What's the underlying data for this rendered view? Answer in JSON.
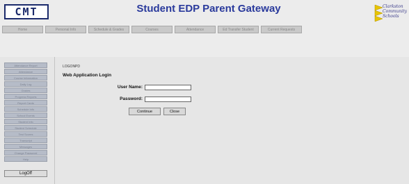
{
  "header": {
    "logo_text": "CMT",
    "title": "Student EDP Parent Gateway",
    "district_logo_lines": [
      "Clarkston",
      "Community",
      "Schools"
    ]
  },
  "topnav": {
    "items": [
      {
        "label": "Home"
      },
      {
        "label": "Personal Info"
      },
      {
        "label": "Schedule & Grades"
      },
      {
        "label": "Courses"
      },
      {
        "label": "Attendance"
      },
      {
        "label": "Ed Transfer Student"
      },
      {
        "label": "Current Requests"
      }
    ]
  },
  "sidebar": {
    "items": [
      {
        "label": "Attendance Report"
      },
      {
        "label": "Attendance"
      },
      {
        "label": "Course Information"
      },
      {
        "label": "Daily Log"
      },
      {
        "label": "Grades"
      },
      {
        "label": "Progress Reports"
      },
      {
        "label": "Report Cards"
      },
      {
        "label": "Schedule Info"
      },
      {
        "label": "School Events"
      },
      {
        "label": "Student Info"
      },
      {
        "label": "Student Schedule"
      },
      {
        "label": "Test Scores"
      },
      {
        "label": "Transcript"
      },
      {
        "label": "Messages"
      },
      {
        "label": "Change Password"
      },
      {
        "label": "Help"
      },
      {
        "label": "LogOff"
      }
    ]
  },
  "main": {
    "breadcrumb": "LOGONPD",
    "heading": "Web Application Login",
    "username_label": "User Name:",
    "username_value": "",
    "password_label": "Password:",
    "password_value": "",
    "continue_label": "Continue",
    "close_label": "Close"
  },
  "colors": {
    "title_blue": "#2a3a9c",
    "logo_navy": "#1b2a6b",
    "page_bg": "#e6e6e6",
    "sidebar_button": "#b6bcc8"
  }
}
